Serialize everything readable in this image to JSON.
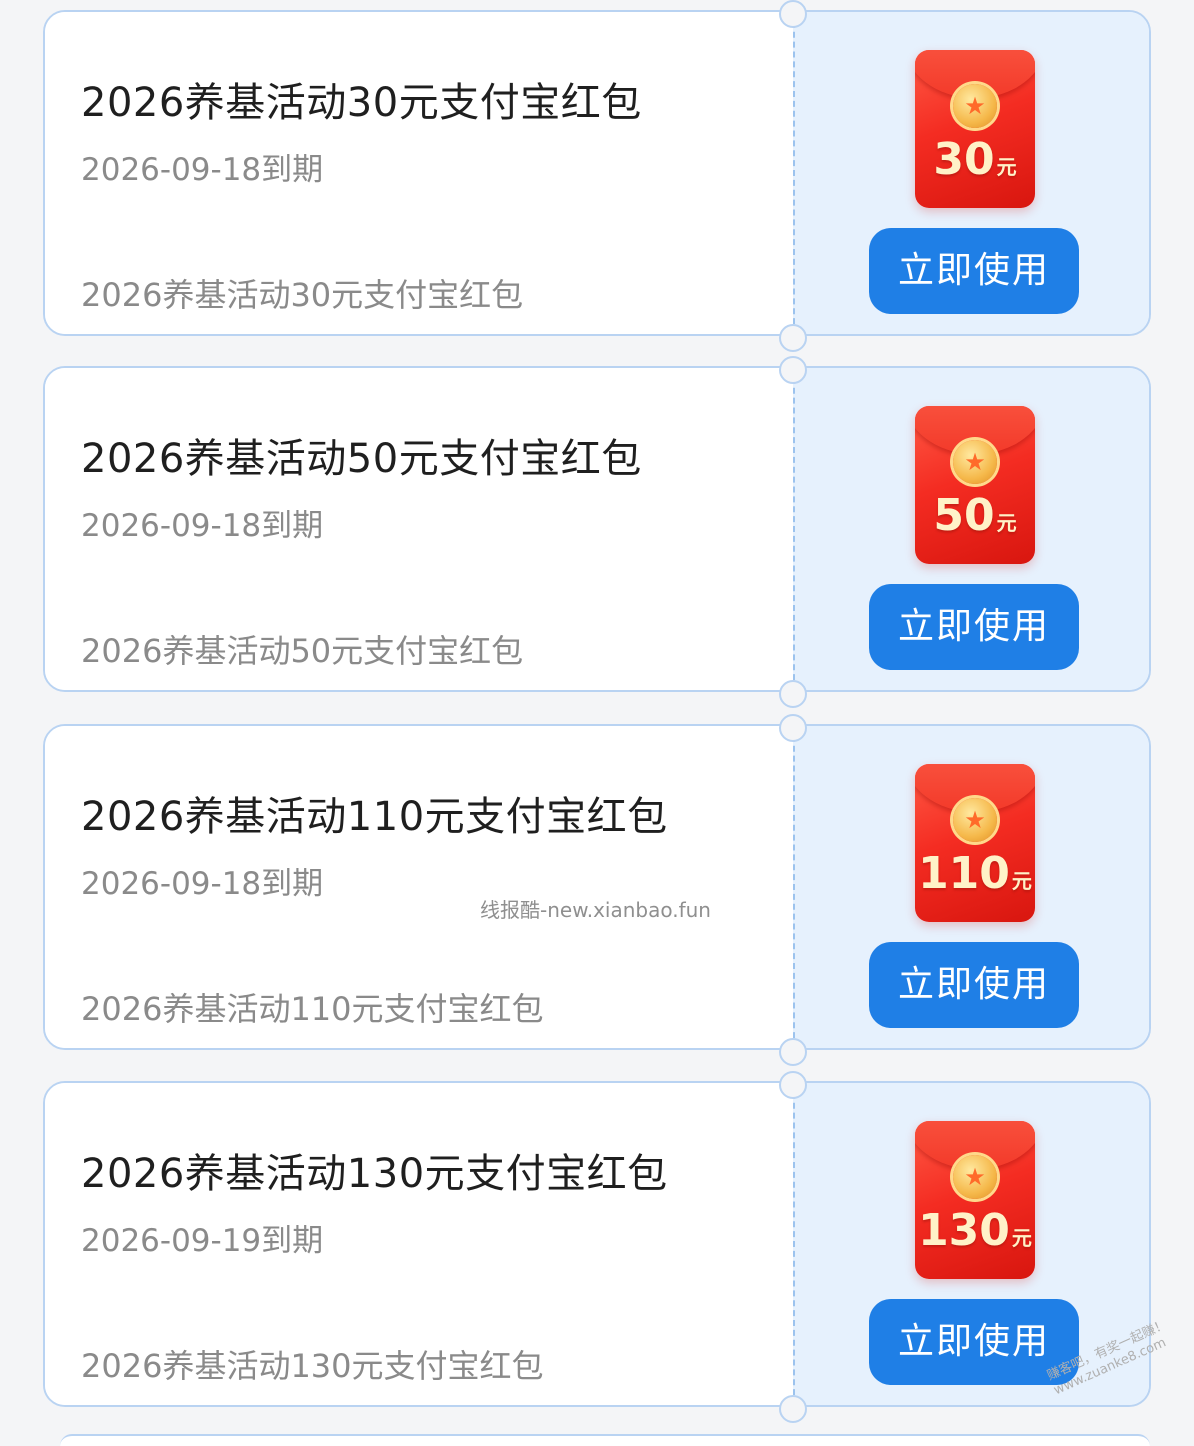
{
  "coupons": [
    {
      "title": "2026养基活动30元支付宝红包",
      "expire": "2026-09-18到期",
      "desc": "2026养基活动30元支付宝红包",
      "amount": "30",
      "unit": "元",
      "button": "立即使用"
    },
    {
      "title": "2026养基活动50元支付宝红包",
      "expire": "2026-09-18到期",
      "desc": "2026养基活动50元支付宝红包",
      "amount": "50",
      "unit": "元",
      "button": "立即使用"
    },
    {
      "title": "2026养基活动110元支付宝红包",
      "expire": "2026-09-18到期",
      "desc": "2026养基活动110元支付宝红包",
      "amount": "110",
      "unit": "元",
      "button": "立即使用"
    },
    {
      "title": "2026养基活动130元支付宝红包",
      "expire": "2026-09-19到期",
      "desc": "2026养基活动130元支付宝红包",
      "amount": "130",
      "unit": "元",
      "button": "立即使用"
    }
  ],
  "watermark": "线报酷-new.xianbao.fun",
  "corner_watermark": {
    "line1": "赚客吧，有奖一起赚！",
    "line2": "www.zuanke8.com"
  },
  "colors": {
    "button": "#1f7fe6",
    "coupon_border": "#b9d3f2",
    "coupon_right_bg": "#e6f1fd",
    "envelope": "#f42c22"
  }
}
